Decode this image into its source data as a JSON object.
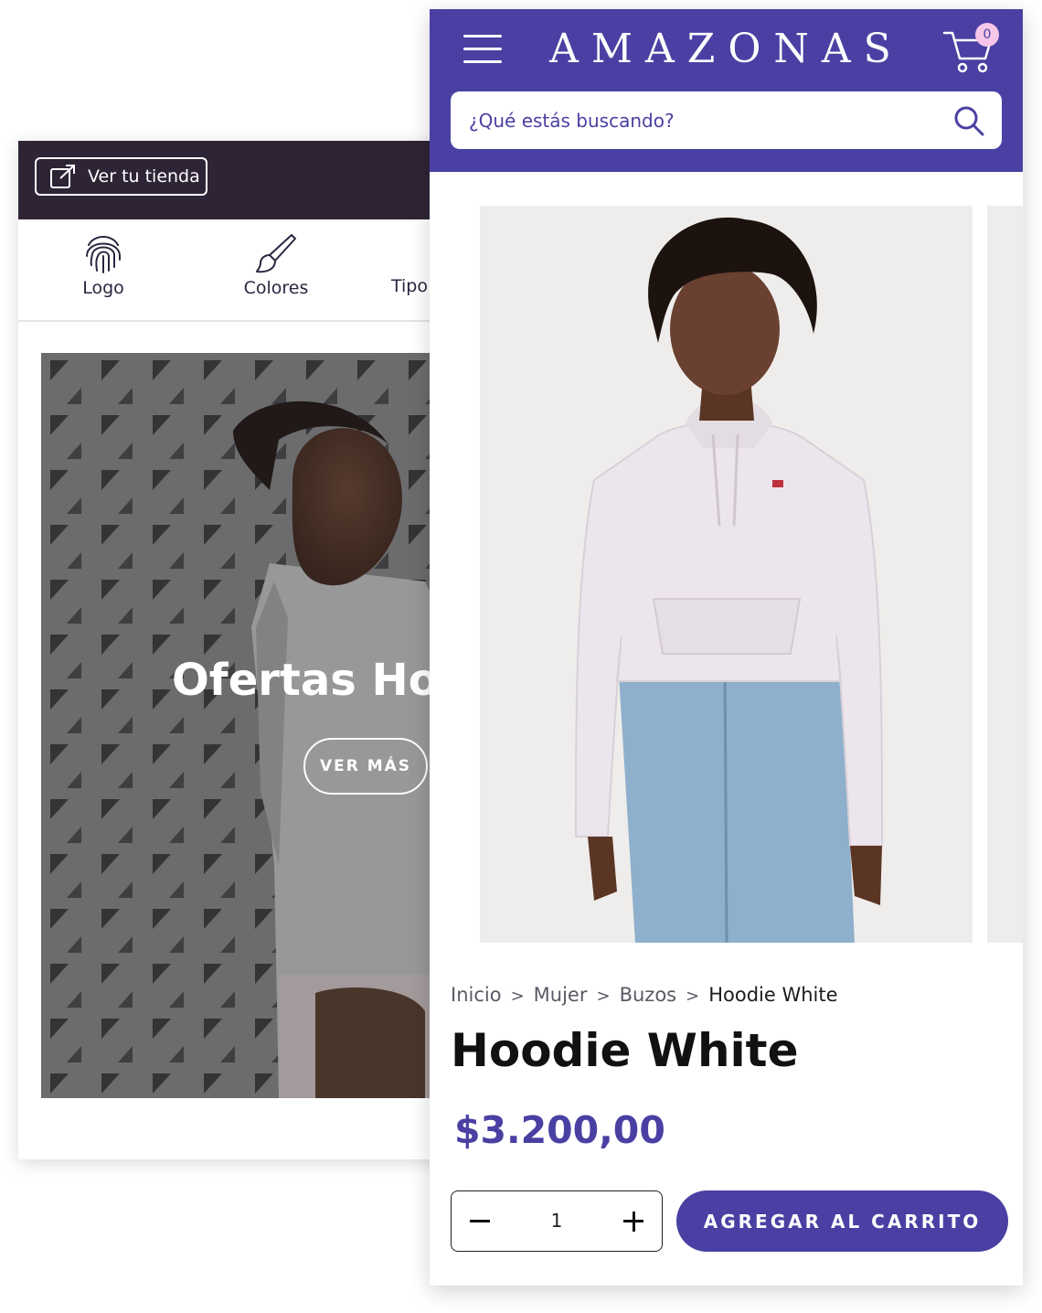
{
  "editor": {
    "view_store_label": "Ver tu tienda",
    "tools": [
      {
        "label": "Logo",
        "icon": "fingerprint-icon"
      },
      {
        "label": "Colores",
        "icon": "brush-icon"
      },
      {
        "label": "Tipo",
        "icon": "type-icon"
      }
    ],
    "hero": {
      "title": "Ofertas Ho",
      "button_label": "VER MÁS"
    }
  },
  "store": {
    "brand": "AMAZONAS",
    "cart_count": "0",
    "search": {
      "placeholder": "¿Qué estás buscando?"
    },
    "breadcrumb": [
      {
        "label": "Inicio"
      },
      {
        "label": "Mujer"
      },
      {
        "label": "Buzos"
      },
      {
        "label": "Hoodie White"
      }
    ],
    "breadcrumb_separator": ">",
    "product": {
      "title": "Hoodie White",
      "price": "$3.200,00",
      "quantity": "1",
      "add_to_cart_label": "AGREGAR AL CARRITO"
    },
    "colors": {
      "brand_primary": "#4a40a3",
      "badge": "#f6c6e8",
      "editor_bar": "#2e2436"
    }
  }
}
